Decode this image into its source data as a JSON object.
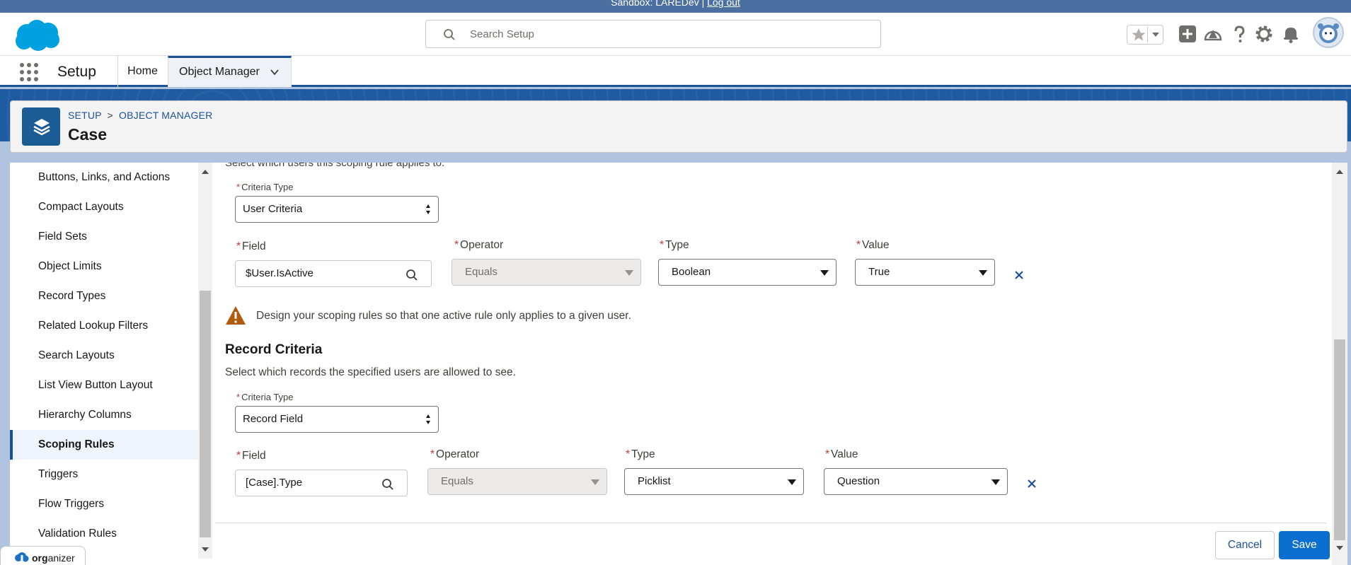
{
  "sandbox_bar": {
    "text": "Sandbox: LAREDev |",
    "logout": "Log out"
  },
  "header": {
    "search_placeholder": "Search Setup",
    "icons": [
      "star-icon",
      "chevron-down-icon",
      "plus-icon",
      "trailhead-icon",
      "help-icon",
      "gear-icon",
      "bell-icon",
      "avatar"
    ]
  },
  "nav": {
    "app_name": "Setup",
    "tabs": [
      {
        "label": "Home"
      },
      {
        "label": "Object Manager",
        "active": true
      }
    ]
  },
  "page_header": {
    "breadcrumb_1": "SETUP",
    "breadcrumb_sep": ">",
    "breadcrumb_2": "OBJECT MANAGER",
    "title": "Case"
  },
  "sidebar": {
    "items": [
      {
        "label": "Buttons, Links, and Actions"
      },
      {
        "label": "Compact Layouts"
      },
      {
        "label": "Field Sets"
      },
      {
        "label": "Object Limits"
      },
      {
        "label": "Record Types"
      },
      {
        "label": "Related Lookup Filters"
      },
      {
        "label": "Search Layouts"
      },
      {
        "label": "List View Button Layout"
      },
      {
        "label": "Hierarchy Columns"
      },
      {
        "label": "Scoping Rules",
        "active": true
      },
      {
        "label": "Triggers"
      },
      {
        "label": "Flow Triggers"
      },
      {
        "label": "Validation Rules"
      }
    ]
  },
  "user_criteria": {
    "cut_text": "Select which users this scoping rule applies to.",
    "criteria_type_label": "Criteria Type",
    "criteria_type_value": "User Criteria",
    "field_label": "Field",
    "field_value": "$User.IsActive",
    "operator_label": "Operator",
    "operator_value": "Equals",
    "type_label": "Type",
    "type_value": "Boolean",
    "value_label": "Value",
    "value_value": "True"
  },
  "warning": "Design your scoping rules so that one active rule only applies to a given user.",
  "record_criteria": {
    "title": "Record Criteria",
    "description": "Select which records the specified users are allowed to see.",
    "criteria_type_label": "Criteria Type",
    "criteria_type_value": "Record Field",
    "field_label": "Field",
    "field_value": "[Case].Type",
    "operator_label": "Operator",
    "operator_value": "Equals",
    "type_label": "Type",
    "type_value": "Picklist",
    "value_label": "Value",
    "value_value": "Question"
  },
  "required_mark": "*",
  "footer": {
    "cancel": "Cancel",
    "save": "Save"
  },
  "organizer": {
    "bold": "org",
    "rest": "anizer"
  },
  "colors": {
    "brand": "#1b5297",
    "save_button": "#0b6fd0",
    "required": "#c23934",
    "warning": "#dd7a01"
  }
}
